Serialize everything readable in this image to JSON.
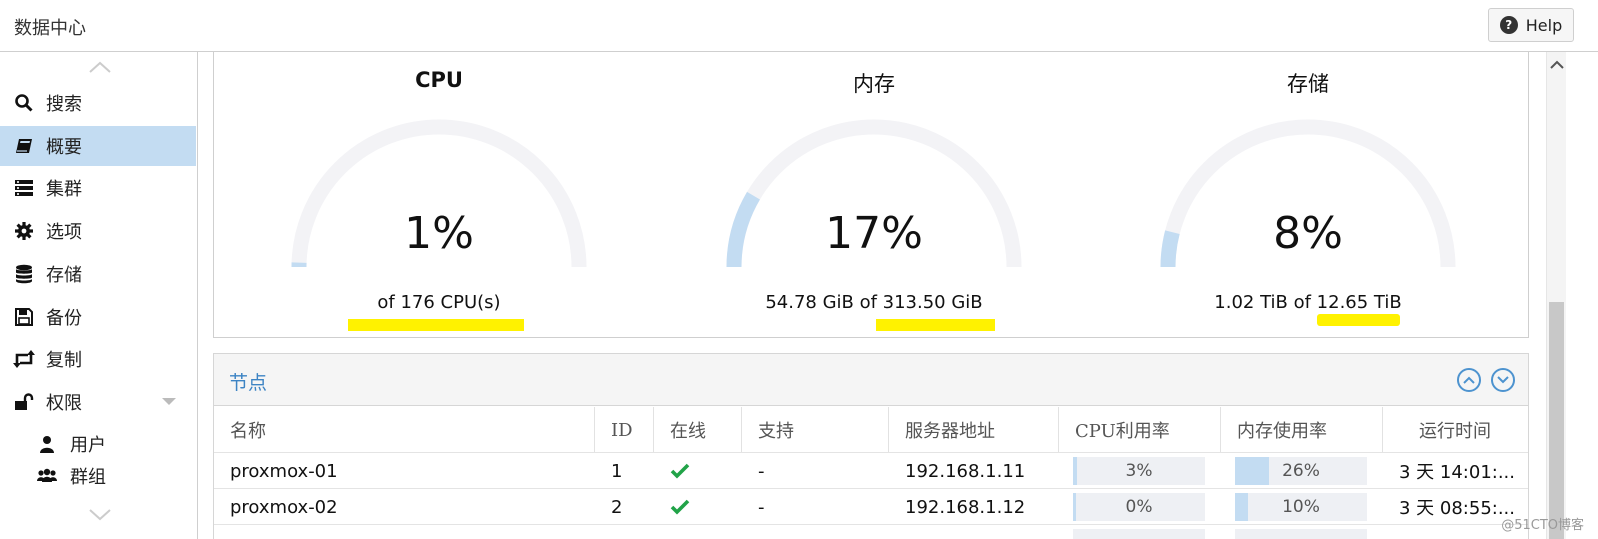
{
  "topbar": {
    "title": "数据中心",
    "help_label": "Help"
  },
  "sidebar": {
    "items": [
      {
        "label": "搜索",
        "icon": "search-icon"
      },
      {
        "label": "概要",
        "icon": "book-icon",
        "active": true
      },
      {
        "label": "集群",
        "icon": "server-icon"
      },
      {
        "label": "选项",
        "icon": "gear-icon"
      },
      {
        "label": "存储",
        "icon": "database-icon"
      },
      {
        "label": "备份",
        "icon": "floppy-icon"
      },
      {
        "label": "复制",
        "icon": "retweet-icon"
      },
      {
        "label": "权限",
        "icon": "unlock-icon"
      },
      {
        "label": "用户",
        "icon": "user-icon"
      },
      {
        "label": "群组",
        "icon": "users-icon"
      }
    ]
  },
  "gauges": {
    "cpu": {
      "title": "CPU",
      "value": "1%",
      "fraction": 0.01,
      "sub": "of 176 CPU(s)"
    },
    "memory": {
      "title": "内存",
      "value": "17%",
      "fraction": 0.17,
      "sub": "54.78 GiB of 313.50 GiB"
    },
    "storage": {
      "title": "存储",
      "value": "8%",
      "fraction": 0.08,
      "sub": "1.02 TiB of 12.65 TiB"
    }
  },
  "nodes": {
    "title": "节点",
    "columns": [
      "名称",
      "ID",
      "在线",
      "支持",
      "服务器地址",
      "CPU利用率",
      "内存使用率",
      "运行时间"
    ],
    "rows": [
      {
        "name": "proxmox-01",
        "id": "1",
        "online": true,
        "support": "-",
        "ip": "192.168.1.11",
        "cpu": "3%",
        "cpu_fraction": 0.03,
        "mem": "26%",
        "mem_fraction": 0.26,
        "uptime": "3 天 14:01:..."
      },
      {
        "name": "proxmox-02",
        "id": "2",
        "online": true,
        "support": "-",
        "ip": "192.168.1.12",
        "cpu": "0%",
        "cpu_fraction": 0.0,
        "mem": "10%",
        "mem_fraction": 0.1,
        "uptime": "3 天 08:55:..."
      }
    ]
  },
  "watermark": "@51CTO博客",
  "colors": {
    "accent": "#3d84c4",
    "selection": "#c3dcf2",
    "highlight": "#fff200",
    "online": "#21a348"
  }
}
